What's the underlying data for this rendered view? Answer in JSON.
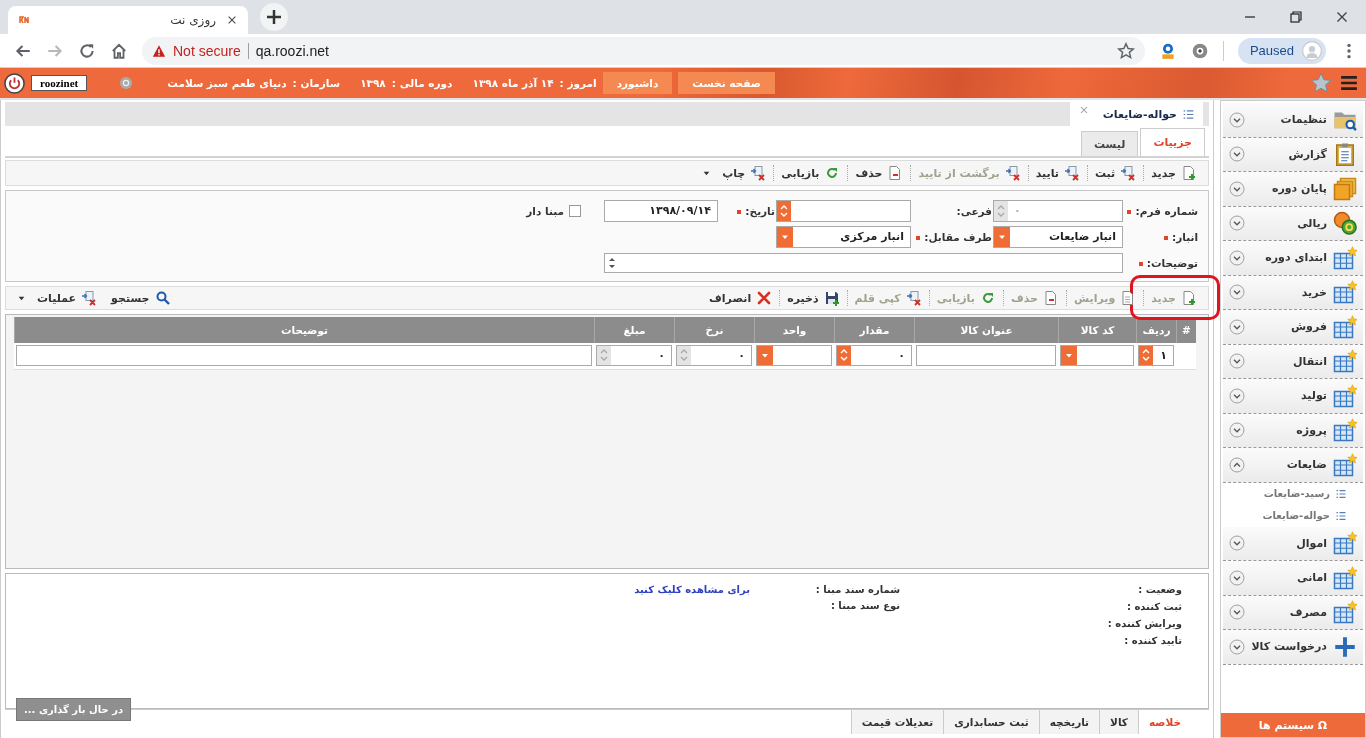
{
  "browser": {
    "tab_title": "روزی نت",
    "security": "Not secure",
    "url": "qa.roozi.net",
    "profile_status": "Paused"
  },
  "header": {
    "user": "roozinet",
    "org_label": "سازمان :",
    "org": "دنیای طعم سبز سلامت",
    "fiscal_label": "دوره مالی :",
    "fiscal": "۱۳۹۸",
    "today_label": "امروز :",
    "today": "۱۴ آذر ماه ۱۳۹۸",
    "buttons": [
      "صفحه نخست",
      "داشبورد"
    ]
  },
  "document_tab": {
    "title": "حواله-ضایعات"
  },
  "view_tabs": [
    {
      "label": "جزییات",
      "selected": true
    },
    {
      "label": "لیست",
      "selected": false
    }
  ],
  "toolbar": [
    {
      "label": "جدید",
      "kind": "new",
      "disabled": false,
      "dropdown": false
    },
    {
      "label": "ثبت",
      "kind": "post",
      "disabled": false,
      "dropdown": false
    },
    {
      "label": "تایید",
      "kind": "post",
      "disabled": false,
      "dropdown": false
    },
    {
      "label": "برگشت از تایید",
      "kind": "post",
      "disabled": true,
      "dropdown": false
    },
    {
      "label": "حذف",
      "kind": "delete",
      "disabled": false,
      "dropdown": false
    },
    {
      "label": "بازیابی",
      "kind": "refresh",
      "disabled": false,
      "dropdown": false
    },
    {
      "label": "چاپ",
      "kind": "post",
      "disabled": false,
      "dropdown": true
    }
  ],
  "form": {
    "rows": [
      [
        {
          "label": "شماره فرم:",
          "required": true,
          "kind": "spinner",
          "disabled": true,
          "placeholder": "۰"
        },
        {
          "label": "فرعی:",
          "required": false,
          "kind": "spinner",
          "disabled": false
        },
        {
          "label": "تاریخ:",
          "required": true,
          "kind": "text",
          "disabled": false,
          "value": "۱۳۹۸/۰۹/۱۴"
        }
      ],
      [
        {
          "label": "انبار:",
          "required": true,
          "kind": "dropdown",
          "disabled": false,
          "value": "انبار ضایعات"
        },
        {
          "label": "طرف مقابل:",
          "required": true,
          "kind": "dropdown",
          "disabled": false,
          "value": "انبار مرکزی"
        }
      ],
      [
        {
          "label": "توضیحات:",
          "required": true,
          "kind": "memo",
          "disabled": false
        }
      ]
    ],
    "checkbox": {
      "label": "مبنا دار",
      "checked": false
    }
  },
  "grid_toolbar": {
    "items": [
      {
        "label": "جدید",
        "kind": "new",
        "disabled": true,
        "highlighted": true
      },
      {
        "label": "ویرایش",
        "kind": "edit",
        "disabled": true,
        "highlighted": false
      },
      {
        "label": "حذف",
        "kind": "delete",
        "disabled": true,
        "highlighted": false
      },
      {
        "label": "بازیابی",
        "kind": "refresh",
        "disabled": true,
        "highlighted": false
      },
      {
        "label": "کپی قلم",
        "kind": "post",
        "disabled": true,
        "highlighted": false
      },
      {
        "label": "ذخیره",
        "kind": "save",
        "disabled": false,
        "highlighted": false
      },
      {
        "label": "انصراف",
        "kind": "cancel",
        "disabled": false,
        "highlighted": false
      }
    ],
    "tools": [
      {
        "label": "جستجو",
        "kind": "search",
        "dropdown": false
      },
      {
        "label": "عملیات",
        "kind": "post",
        "dropdown": true
      }
    ]
  },
  "table": {
    "columns": [
      "#",
      "ردیف",
      "کد کالا",
      "عنوان کالا",
      "مقدار",
      "واحد",
      "نرخ",
      "مبلغ",
      "توضیحات"
    ],
    "rows": [
      {
        "cells": [
          {
            "kind": "blank"
          },
          {
            "kind": "spinner",
            "value": "۱"
          },
          {
            "kind": "dropdown"
          },
          {
            "kind": "text"
          },
          {
            "kind": "spinner",
            "value": "۰"
          },
          {
            "kind": "dropdown"
          },
          {
            "kind": "number",
            "value": "۰"
          },
          {
            "kind": "number",
            "value": "۰"
          },
          {
            "kind": "text"
          }
        ]
      }
    ]
  },
  "summary": {
    "status_fields": [
      "وضعیت :",
      "ثبت کننده :",
      "ویرایش کننده :",
      "تایید کننده :"
    ],
    "source_fields": [
      {
        "label": "شماره سند مبنا :",
        "link": "برای مشاهده کلیک کنید"
      },
      {
        "label": "نوع سند مبنا :"
      }
    ],
    "loading": "در حال بار گذاری ..."
  },
  "bottom_tabs": [
    {
      "label": "خلاصه",
      "selected": true
    },
    {
      "label": "کالا",
      "selected": false
    },
    {
      "label": "تاریخچه",
      "selected": false
    },
    {
      "label": "ثبت حسابداری",
      "selected": false
    },
    {
      "label": "تعدیلات قیمت",
      "selected": false
    }
  ],
  "sidebar": {
    "items": [
      {
        "label": "تنظیمات",
        "kind": "folder",
        "expanded": false
      },
      {
        "label": "گزارش",
        "kind": "clipboard",
        "expanded": false
      },
      {
        "label": "پایان دوره",
        "kind": "folders",
        "expanded": false
      },
      {
        "label": "ریالی",
        "kind": "coins",
        "expanded": false
      },
      {
        "label": "ابتدای دوره",
        "kind": "table",
        "expanded": false
      },
      {
        "label": "خرید",
        "kind": "table",
        "expanded": false
      },
      {
        "label": "فروش",
        "kind": "table",
        "expanded": false
      },
      {
        "label": "انتقال",
        "kind": "table",
        "expanded": false
      },
      {
        "label": "تولید",
        "kind": "table",
        "expanded": false
      },
      {
        "label": "پروژه",
        "kind": "table",
        "expanded": false
      },
      {
        "label": "ضایعات",
        "kind": "table",
        "expanded": true,
        "children": [
          {
            "label": "رسید-ضایعات"
          },
          {
            "label": "حواله-ضایعات"
          }
        ]
      },
      {
        "label": "اموال",
        "kind": "table",
        "expanded": false
      },
      {
        "label": "امانی",
        "kind": "table",
        "expanded": false
      },
      {
        "label": "مصرف",
        "kind": "table",
        "expanded": false
      },
      {
        "label": "درخواست کالا",
        "kind": "plus",
        "expanded": false
      }
    ],
    "systems_button": {
      "symbol": "Ω",
      "label": "سیستم ها"
    }
  }
}
